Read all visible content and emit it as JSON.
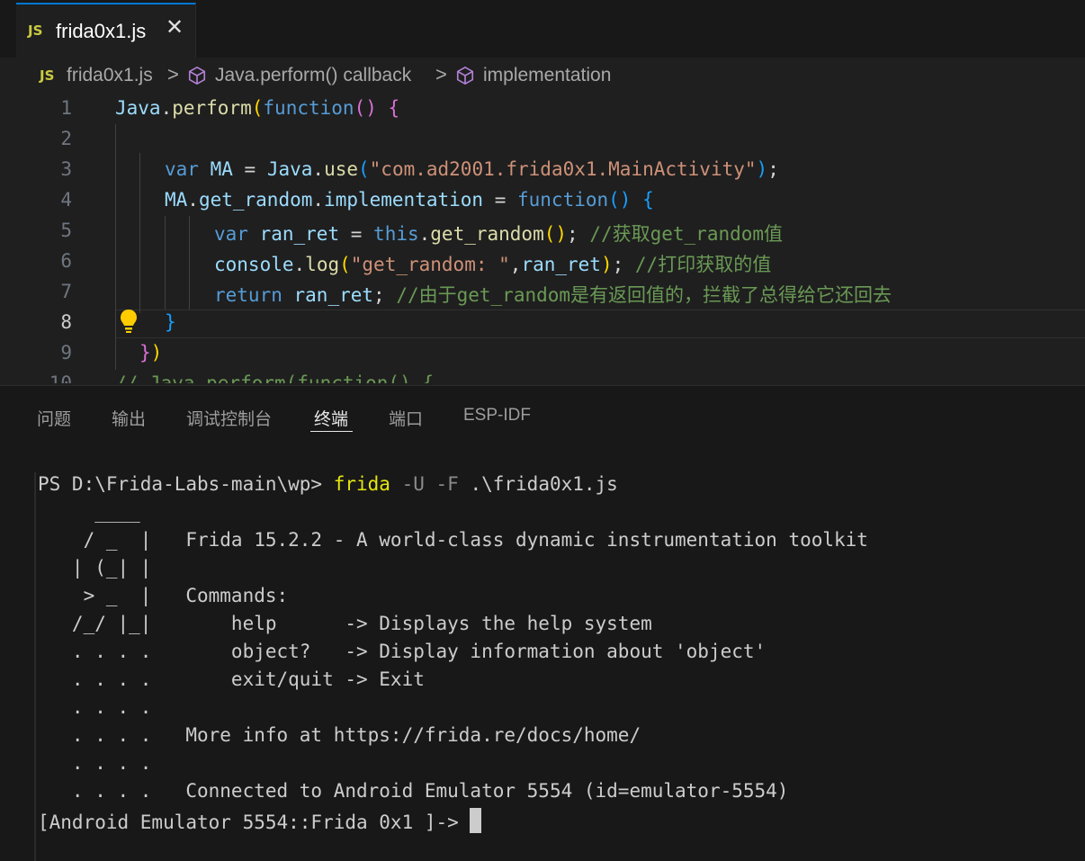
{
  "tab": {
    "badge": "JS",
    "label": "frida0x1.js",
    "close": "✕"
  },
  "breadcrumb": {
    "badge": "JS",
    "file": "frida0x1.js",
    "sep": ">",
    "callback": "Java.perform() callback",
    "impl": "implementation"
  },
  "editor": {
    "line_numbers": [
      "1",
      "2",
      "3",
      "4",
      "5",
      "6",
      "7",
      "8",
      "9",
      "10"
    ],
    "partial_line_10": "// Java.perform(function() {"
  },
  "code_tokens": {
    "l1_java": "Java",
    "l1_dot": ".",
    "l1_perform": "perform",
    "l1_paren": "(",
    "l1_function": "function",
    "l1_args": "()",
    "l1_space": " ",
    "l1_brace": "{",
    "l3_var": "var",
    "l3_ma": "MA",
    "l3_eq": " = ",
    "l3_java": "Java",
    "l3_dot": ".",
    "l3_use": "use",
    "l3_p1": "(",
    "l3_str": "\"com.ad2001.frida0x1.MainActivity\"",
    "l3_p2": ")",
    "l3_semi": ";",
    "l4_ma": "MA",
    "l4_dot1": ".",
    "l4_get": "get_random",
    "l4_dot2": ".",
    "l4_impl": "implementation",
    "l4_eq": " = ",
    "l4_function": "function",
    "l4_args": "()",
    "l4_space": " ",
    "l4_brace": "{",
    "l5_var": "var",
    "l5_ranret": "ran_ret",
    "l5_eq": " = ",
    "l5_this": "this",
    "l5_dot": ".",
    "l5_get": "get_random",
    "l5_args": "()",
    "l5_semi": "; ",
    "l5_comment": "//获取get_random值",
    "l6_console": "console",
    "l6_dot": ".",
    "l6_log": "log",
    "l6_p1": "(",
    "l6_str": "\"get_random: \"",
    "l6_comma": ",",
    "l6_ranret": "ran_ret",
    "l6_p2": ")",
    "l6_semi": "; ",
    "l6_comment": "//打印获取的值",
    "l7_return": "return",
    "l7_ranret": "ran_ret",
    "l7_semi": "; ",
    "l7_comment": "//由于get_random是有返回值的，拦截了总得给它还回去",
    "l8_brace": "}",
    "l9_brace": "}",
    "l9_paren": ")"
  },
  "panel": {
    "tabs": [
      "问题",
      "输出",
      "调试控制台",
      "终端",
      "端口",
      "ESP-IDF"
    ],
    "active_tab": "终端"
  },
  "terminal": {
    "prompt": "PS D:\\Frida-Labs-main\\wp> ",
    "cmd": "frida",
    "flags": " -U -F",
    "arg": " .\\frida0x1.js",
    "banner": [
      "     ____",
      "    / _  |   Frida 15.2.2 - A world-class dynamic instrumentation toolkit",
      "   | (_| |",
      "    > _  |   Commands:",
      "   /_/ |_|       help      -> Displays the help system",
      "   . . . .       object?   -> Display information about 'object'",
      "   . . . .       exit/quit -> Exit",
      "   . . . .",
      "   . . . .   More info at https://frida.re/docs/home/",
      "   . . . .",
      "   . . . .   Connected to Android Emulator 5554 (id=emulator-5554)"
    ],
    "repl_prompt": "[Android Emulator 5554::Frida 0x1 ]-> "
  },
  "icons": {
    "tab_file": "js-file-icon",
    "breadcrumb_symbol": "cube-symbol-icon",
    "hint": "lightbulb-icon"
  },
  "colors": {
    "accent": "#0078d4",
    "keyword": "#569cd6",
    "function": "#dcdcaa",
    "variable": "#9cdcfe",
    "string": "#ce9178",
    "comment": "#6a9955",
    "js_badge": "#cbcb41"
  }
}
